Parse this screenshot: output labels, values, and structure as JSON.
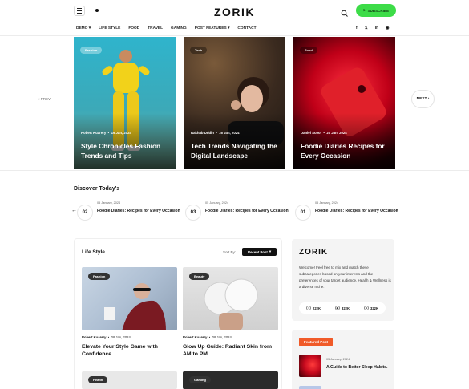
{
  "header": {
    "logo": "ZORIK",
    "subscribe_label": "SUBSCRIBE",
    "nav": [
      "DEMO ▾",
      "LIFE STYLE",
      "FOOD",
      "TRAVEL",
      "GAMING",
      "POST FEATURES ▾",
      "CONTACT"
    ],
    "socials": [
      "f",
      "𝕏",
      "in",
      "◉"
    ]
  },
  "hero": {
    "prev_label": "‹ PREV",
    "next_label": "NEXT ›",
    "cards": [
      {
        "tag": "Fashion",
        "author": "Robert Kuarery",
        "date": "19 Jan, 2024",
        "title": "Style Chronicles Fashion Trends and Tips"
      },
      {
        "tag": "Tech",
        "author": "Rakhab Uddin",
        "date": "16 Jan, 2024",
        "title": "Tech Trends Navigating the Digital Landscape"
      },
      {
        "tag": "Food",
        "author": "Daniel Scoot",
        "date": "20 Jan, 2024",
        "title": "Foodie Diaries Recipes for Every Occasion"
      }
    ]
  },
  "discover": {
    "title": "Discover Today's",
    "items": [
      {
        "num": "02",
        "date": "05 January, 2024",
        "text": "Foodie Diaries: Recipes for Every Occasion"
      },
      {
        "num": "03",
        "date": "05 January, 2024",
        "text": "Foodie Diaries: Recipes for Every Occasion"
      },
      {
        "num": "01",
        "date": "05 January, 2024",
        "text": "Foodie Diaries: Recipes for Every Occasion"
      }
    ]
  },
  "lifestyle": {
    "title": "Life Style",
    "sort_label": "Sort By:",
    "sort_value": "Recent Post",
    "posts": [
      {
        "tag": "Fashion",
        "author": "Robert Kuarery",
        "date": "08 Jan, 2024",
        "title": "Elevate Your Style Game with Confidence"
      },
      {
        "tag": "Beauty",
        "author": "Robert Kuarery",
        "date": "08 Jan, 2024",
        "title": "Glow Up Guide: Radiant Skin from AM to PM"
      },
      {
        "tag": "Health"
      },
      {
        "tag": "Gaming"
      }
    ]
  },
  "sidebar": {
    "logo": "ZORIK",
    "text": "Welcome! Feel free to mix and match these subcategories based on your interests and the preferences of your target audience. Health & Wellness is a diverse niche.",
    "stats": [
      "222K",
      "322K",
      "322K"
    ],
    "featured_label": "Featured Post",
    "featured": {
      "date": "05 January, 2024",
      "title": "A Guide to Better Sleep Habits."
    }
  },
  "colors": {
    "accent_green": "#3ddc48",
    "accent_orange": "#f05a28"
  }
}
